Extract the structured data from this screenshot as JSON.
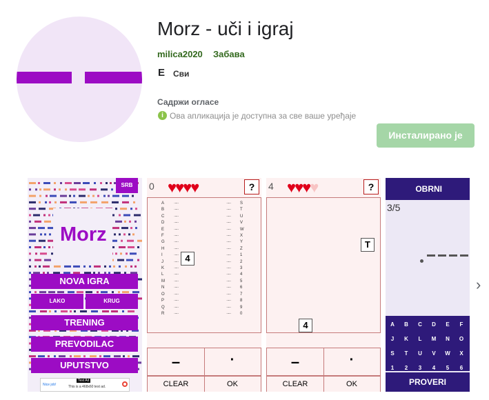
{
  "app": {
    "title": "Morz - uči i igraj",
    "developer": "milica2020",
    "category": "Забава",
    "rating_badge": "E",
    "rating_text": "Сви",
    "ads_notice": "Садржи огласе",
    "compat_icon": "info-icon",
    "compat_text": "Ова апликација је доступна за све ваше уређаје",
    "install_label": "Инсталирано је"
  },
  "screenshots": {
    "shot1": {
      "srb": "SRB",
      "logo_text": "Morz",
      "buttons": [
        "NOVA IGRA",
        "TRENING",
        "PREVODILAC",
        "UPUTSTVO"
      ],
      "sub_buttons": [
        "LAKO",
        "KRUG"
      ],
      "ad_left": "Nice job!",
      "ad_center": "This is a 468x60 test ad.",
      "ad_tag": "Test Ad"
    },
    "shot2": {
      "score": "0",
      "hearts": 4,
      "help": "?",
      "tile": "4",
      "dash": "–",
      "dot": "·",
      "clear": "CLEAR",
      "ok": "OK"
    },
    "shot3": {
      "score": "4",
      "hearts": 3,
      "help": "?",
      "tile_top": "T",
      "tile_bottom": "4",
      "dash": "–",
      "dot": "·",
      "clear": "CLEAR",
      "ok": "OK"
    },
    "shot4": {
      "flip": "OBRNI",
      "progress": "3/5",
      "keys_row1": [
        "A",
        "B",
        "C",
        "D",
        "E",
        "F"
      ],
      "keys_row2": [
        "J",
        "K",
        "L",
        "M",
        "N",
        "O"
      ],
      "keys_row3": [
        "S",
        "T",
        "U",
        "V",
        "W",
        "X"
      ],
      "keys_row4": [
        "1",
        "2",
        "3",
        "4",
        "5",
        "6"
      ],
      "check": "PROVERI"
    }
  },
  "morse_left": [
    "A",
    "B",
    "C",
    "D",
    "E",
    "F",
    "G",
    "H",
    "I",
    "J",
    "K",
    "L",
    "M",
    "N",
    "O",
    "P",
    "Q",
    "R"
  ],
  "morse_right": [
    "S",
    "T",
    "U",
    "V",
    "W",
    "X",
    "Y",
    "Z",
    "1",
    "2",
    "3",
    "4",
    "5",
    "6",
    "7",
    "8",
    "9",
    "0"
  ],
  "next_icon": "chevron-right-icon",
  "colors": {
    "accent": "#9c0cc4",
    "dev_green": "#33691e",
    "install_bg": "#a5d6a7",
    "heart": "#e0001a",
    "navy": "#2e1a7a"
  }
}
